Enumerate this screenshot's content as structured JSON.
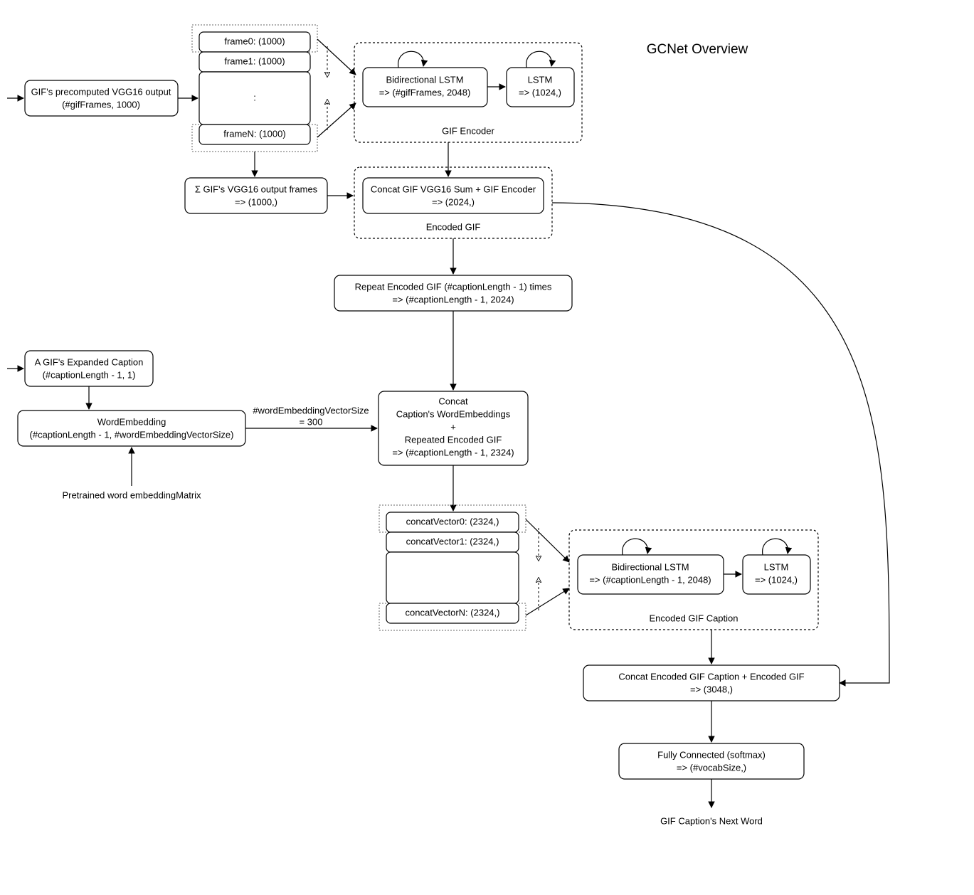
{
  "title": "GCNet Overview",
  "input_vgg": {
    "l1": "GIF's precomputed VGG16 output",
    "l2": "(#gifFrames, 1000)"
  },
  "frames": {
    "f0": "frame0: (1000)",
    "f1": "frame1: (1000)",
    "dots": ":",
    "fN": "frameN: (1000)"
  },
  "gif_encoder": {
    "bi_l1": "Bidirectional LSTM",
    "bi_l2": "=> (#gifFrames, 2048)",
    "lstm_l1": "LSTM",
    "lstm_l2": "=> (1024,)",
    "label": "GIF Encoder"
  },
  "sum": {
    "l1": "Σ GIF's VGG16 output frames",
    "l2": "=> (1000,)"
  },
  "encoded_gif": {
    "l1": "Concat GIF VGG16 Sum + GIF Encoder",
    "l2": "=> (2024,)",
    "label": "Encoded GIF"
  },
  "repeat": {
    "l1": "Repeat Encoded GIF (#captionLength - 1) times",
    "l2": "=> (#captionLength - 1, 2024)"
  },
  "input_caption": {
    "l1": "A GIF's Expanded Caption",
    "l2": "(#captionLength - 1, 1)"
  },
  "word_embed": {
    "l1": "WordEmbedding",
    "l2": "(#captionLength - 1, #wordEmbeddingVectorSize)"
  },
  "embed_note": "Pretrained word embeddingMatrix",
  "embed_size": {
    "l1": "#wordEmbeddingVectorSize",
    "l2": "= 300"
  },
  "concat_main": {
    "l1": "Concat",
    "l2": "Caption's WordEmbeddings",
    "l3": "+",
    "l4": "Repeated Encoded GIF",
    "l5": "=> (#captionLength - 1, 2324)"
  },
  "cvecs": {
    "c0": "concatVector0: (2324,)",
    "c1": "concatVector1: (2324,)",
    "cN": "concatVectorN: (2324,)"
  },
  "caption_encoder": {
    "bi_l1": "Bidirectional LSTM",
    "bi_l2": "=> (#captionLength - 1, 2048)",
    "lstm_l1": "LSTM",
    "lstm_l2": "=> (1024,)",
    "label": "Encoded GIF Caption"
  },
  "final_concat": {
    "l1": "Concat Encoded GIF Caption + Encoded GIF",
    "l2": "=> (3048,)"
  },
  "fc": {
    "l1": "Fully Connected (softmax)",
    "l2": "=> (#vocabSize,)"
  },
  "output": "GIF Caption's Next Word"
}
